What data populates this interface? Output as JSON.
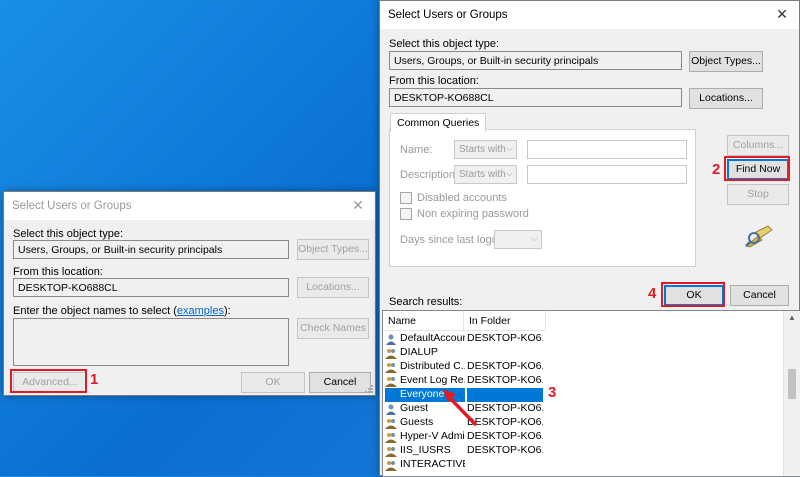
{
  "small_dialog": {
    "title": "Select Users or Groups",
    "object_type_label": "Select this object type:",
    "object_type_value": "Users, Groups, or Built-in security principals",
    "object_types_button": "Object Types...",
    "location_label": "From this location:",
    "location_value": "DESKTOP-KO688CL",
    "locations_button": "Locations...",
    "enter_label_prefix": "Enter the object names to select (",
    "examples_link": "examples",
    "enter_label_suffix": "):",
    "check_names_button": "Check Names",
    "advanced_button": "Advanced...",
    "ok_button": "OK",
    "cancel_button": "Cancel"
  },
  "large_dialog": {
    "title": "Select Users or Groups",
    "object_type_label": "Select this object type:",
    "object_type_value": "Users, Groups, or Built-in security principals",
    "object_types_button": "Object Types...",
    "location_label": "From this location:",
    "location_value": "DESKTOP-KO688CL",
    "locations_button": "Locations...",
    "tab_common_queries": "Common Queries",
    "name_label": "Name:",
    "description_label": "Description:",
    "starts_with": "Starts with",
    "disabled_accounts": "Disabled accounts",
    "non_expiring_password": "Non expiring password",
    "days_since_logon": "Days since last logon:",
    "columns_button": "Columns...",
    "find_now_button": "Find Now",
    "stop_button": "Stop",
    "search_results_label": "Search results:",
    "ok_button": "OK",
    "cancel_button": "Cancel",
    "col_name": "Name",
    "col_folder": "In Folder",
    "rows": [
      {
        "name": "DefaultAccount",
        "folder": "DESKTOP-KO6..."
      },
      {
        "name": "DIALUP",
        "folder": ""
      },
      {
        "name": "Distributed C...",
        "folder": "DESKTOP-KO6..."
      },
      {
        "name": "Event Log Re...",
        "folder": "DESKTOP-KO6..."
      },
      {
        "name": "Everyone",
        "folder": ""
      },
      {
        "name": "Guest",
        "folder": "DESKTOP-KO6..."
      },
      {
        "name": "Guests",
        "folder": "DESKTOP-KO6..."
      },
      {
        "name": "Hyper-V Admi...",
        "folder": "DESKTOP-KO6..."
      },
      {
        "name": "IIS_IUSRS",
        "folder": "DESKTOP-KO6..."
      },
      {
        "name": "INTERACTIVE",
        "folder": ""
      }
    ]
  },
  "annotations": {
    "step1": "1",
    "step2": "2",
    "step3": "3",
    "step4": "4",
    "color": "#e01b24"
  }
}
